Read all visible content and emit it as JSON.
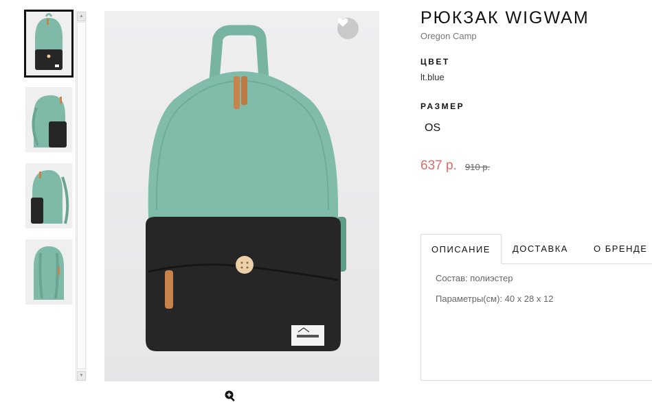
{
  "product": {
    "title": "РЮКЗАК WIGWAM",
    "brand": "Oregon Camp",
    "color_label": "ЦВЕТ",
    "color_value": "lt.blue",
    "size_label": "РАЗМЕР",
    "sizes": [
      "OS"
    ],
    "price": "637 р.",
    "old_price": "910 р."
  },
  "tabs": [
    {
      "label": "ОПИСАНИЕ",
      "active": true
    },
    {
      "label": "ДОСТАВКА",
      "active": false
    },
    {
      "label": "О БРЕНДЕ",
      "active": false
    }
  ],
  "description": {
    "composition": "Состав: полиэстер",
    "params": "Параметры(см): 40 x 28 x 12"
  },
  "gallery": {
    "thumbnails": [
      "front-view",
      "side-view",
      "side-view-2",
      "back-view"
    ],
    "selected_index": 0
  },
  "icons": {
    "favorite": "heart-icon",
    "zoom": "zoom-in-icon"
  },
  "colors": {
    "accent_price": "#e06a68",
    "backpack_mint": "#7fbaa9",
    "backpack_dark": "#222222",
    "leather": "#c8834a"
  }
}
